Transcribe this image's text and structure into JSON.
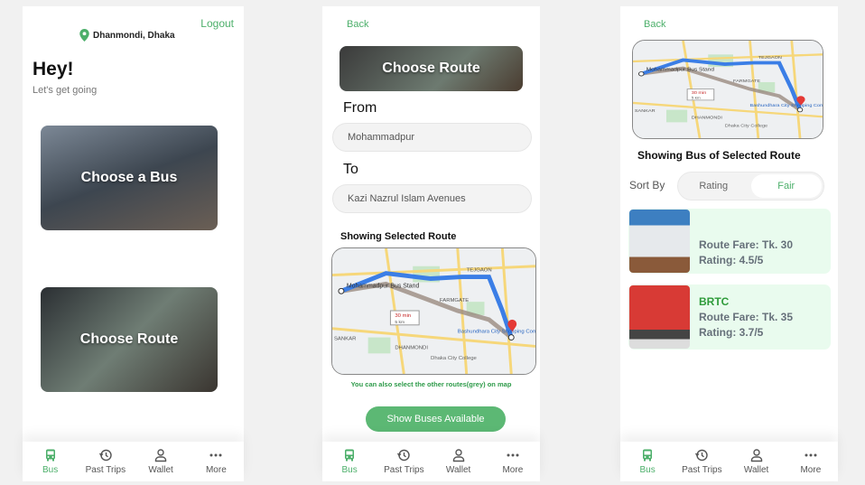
{
  "colors": {
    "accent": "#4caf6a",
    "card_bg": "#e9fbee"
  },
  "screen1": {
    "logout": "Logout",
    "location": "Dhanmondi, Dhaka",
    "location_icon": "map-pin-icon",
    "greeting": "Hey!",
    "subtitle": "Let's get going",
    "card_bus": "Choose a Bus",
    "card_route": "Choose Route"
  },
  "screen2": {
    "back": "Back",
    "banner": "Choose Route",
    "from_label": "From",
    "from_value": "Mohammadpur",
    "to_label": "To",
    "to_value": "Kazi Nazrul Islam Avenues",
    "showing": "Showing Selected Route",
    "hint": "You can also select the other routes(grey) on map",
    "button": "Show Buses Available"
  },
  "map": {
    "stand": "Mohammadpur Bus Stand",
    "tejgaon": "TEJGAON",
    "farmgate": "FARMGATE",
    "time": "30 min",
    "dist": "5 km",
    "dhanmondi": "DHANMONDI",
    "college": "Dhaka City College",
    "mall": "Bashundhara City Shopping Complex",
    "sankar": "SANKAR"
  },
  "screen3": {
    "back": "Back",
    "title": "Showing Bus of Selected Route",
    "sort_by": "Sort By",
    "sort_options": [
      "Rating",
      "Fair"
    ],
    "sort_selected": "Fair",
    "buses": [
      {
        "name": "",
        "fare": "Route Fare: Tk. 30",
        "rating": "Rating: 4.5/5"
      },
      {
        "name": "BRTC",
        "fare": "Route Fare: Tk. 35",
        "rating": "Rating: 3.7/5"
      }
    ]
  },
  "nav": [
    {
      "label": "Bus",
      "icon": "bus-icon"
    },
    {
      "label": "Past Trips",
      "icon": "history-icon"
    },
    {
      "label": "Wallet",
      "icon": "user-icon"
    },
    {
      "label": "More",
      "icon": "more-icon"
    }
  ]
}
